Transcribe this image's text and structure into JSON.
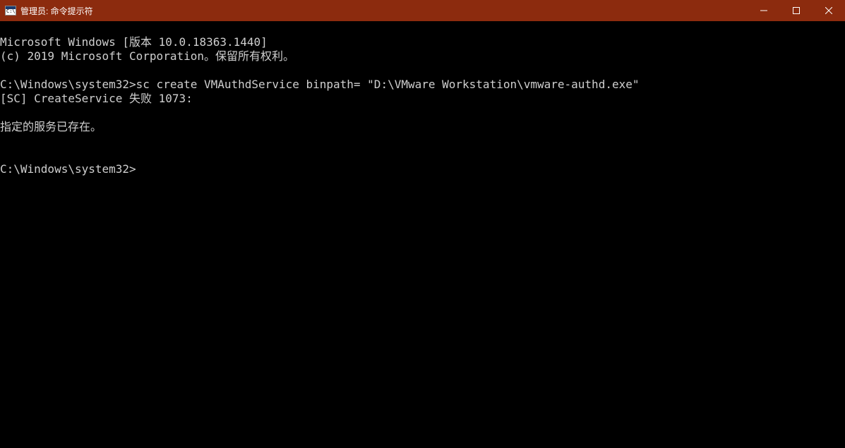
{
  "titlebar": {
    "title": "管理员: 命令提示符"
  },
  "terminal": {
    "line1": "Microsoft Windows [版本 10.0.18363.1440]",
    "line2": "(c) 2019 Microsoft Corporation。保留所有权利。",
    "blank1": "",
    "line3_prompt": "C:\\Windows\\system32>",
    "line3_cmd": "sc create VMAuthdService binpath= \"D:\\VMware Workstation\\vmware-authd.exe\"",
    "line4": "[SC] CreateService 失败 1073:",
    "blank2": "",
    "line5": "指定的服务已存在。",
    "blank3": "",
    "blank4": "",
    "line6_prompt": "C:\\Windows\\system32>"
  }
}
